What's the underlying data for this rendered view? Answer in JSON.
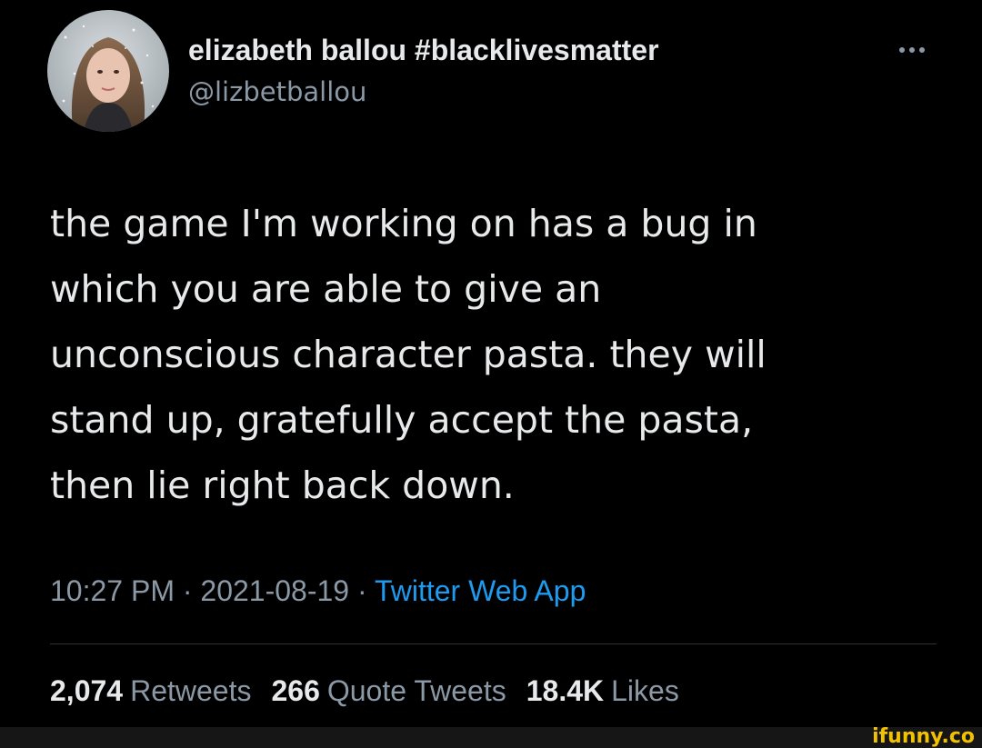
{
  "author": {
    "name": "elizabeth ballou #blacklivesmatter",
    "handle": "@lizbetballou"
  },
  "tweet": {
    "text": "the game I'm working on has a bug in\nwhich you are able to give an\nunconscious character pasta. they will\nstand up, gratefully accept the pasta,\nthen lie right back down.",
    "time": "10:27 PM",
    "separator": "·",
    "date": "2021-08-19",
    "source": "Twitter Web App"
  },
  "stats": {
    "retweets_count": "2,074",
    "retweets_label": "Retweets",
    "quotes_count": "266",
    "quotes_label": "Quote Tweets",
    "likes_count": "18.4K",
    "likes_label": "Likes"
  },
  "icons": {
    "more": "more-horizontal-icon"
  },
  "watermark": {
    "text": "ifunny.co",
    "color": "#f2c200"
  },
  "colors": {
    "background": "#000000",
    "text_primary": "#e7e9ea",
    "text_secondary": "#8b98a5",
    "link": "#1d9bf0",
    "divider": "#2f3336"
  }
}
